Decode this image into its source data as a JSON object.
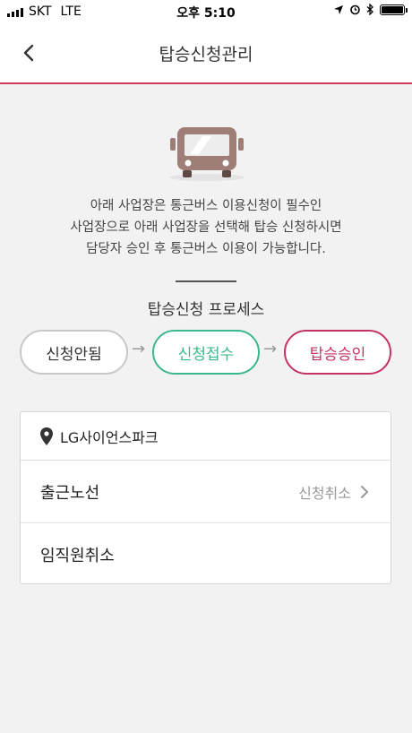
{
  "status_bar": {
    "carrier": "SKT",
    "network": "LTE",
    "time": "오후 5:10"
  },
  "nav": {
    "title": "탑승신청관리",
    "back_icon": "chevron-left-icon"
  },
  "intro": {
    "bus_icon": "bus-icon",
    "lines": [
      "아래 사업장은 통근버스 이용신청이 필수인",
      "사업장으로 아래 사업장을 선택해 탑승 신청하시면",
      "담당자 승인 후 통근버스 이용이 가능합니다."
    ]
  },
  "process": {
    "title": "탑승신청 프로세스",
    "steps": [
      {
        "label": "신청안됨",
        "color": "#c8c8c8"
      },
      {
        "label": "신청접수",
        "color": "#3db88a"
      },
      {
        "label": "탑승승인",
        "color": "#c43460"
      }
    ],
    "arrow": "→"
  },
  "workplace": {
    "icon": "location-pin-icon",
    "name": "LG사이언스파크",
    "rows": [
      {
        "label": "출근노선",
        "status": "신청취소"
      },
      {
        "label": "임직원취소",
        "status": ""
      }
    ]
  },
  "colors": {
    "accent": "#d23a5c",
    "approved": "#c43460",
    "received": "#3db88a"
  }
}
